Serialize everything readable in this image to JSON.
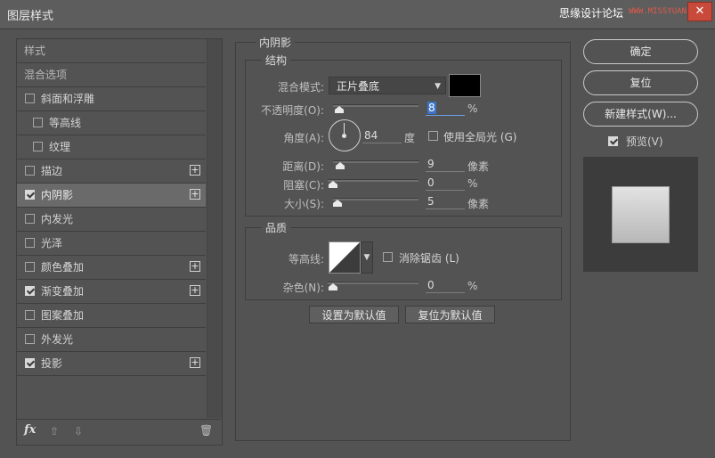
{
  "window": {
    "title": "图层样式",
    "watermark_cn": "思缘设计论坛",
    "watermark_url": "WWW.MISSYUAN.COM",
    "close_glyph": "✕"
  },
  "styles_panel": {
    "header_styles": "样式",
    "header_blend": "混合选项",
    "items": [
      {
        "label": "斜面和浮雕",
        "checked": false,
        "has_plus": false
      },
      {
        "label": "等高线",
        "checked": false,
        "has_plus": false
      },
      {
        "label": "纹理",
        "checked": false,
        "has_plus": false
      },
      {
        "label": "描边",
        "checked": false,
        "has_plus": true
      },
      {
        "label": "内阴影",
        "checked": true,
        "has_plus": true,
        "active": true
      },
      {
        "label": "内发光",
        "checked": false,
        "has_plus": false
      },
      {
        "label": "光泽",
        "checked": false,
        "has_plus": false
      },
      {
        "label": "颜色叠加",
        "checked": false,
        "has_plus": true
      },
      {
        "label": "渐变叠加",
        "checked": true,
        "has_plus": true
      },
      {
        "label": "图案叠加",
        "checked": false,
        "has_plus": false
      },
      {
        "label": "外发光",
        "checked": false,
        "has_plus": false
      },
      {
        "label": "投影",
        "checked": true,
        "has_plus": true
      }
    ],
    "plus_glyph": "+",
    "fx_label": "fx",
    "up_glyph": "⇧",
    "down_glyph": "⇩",
    "trash_glyph": "🗑"
  },
  "inner_shadow": {
    "section_title": "内阴影",
    "structure": {
      "title": "结构",
      "blend_mode_label": "混合模式:",
      "blend_mode_value": "正片叠底",
      "swatch_color": "#000000",
      "opacity_label": "不透明度(O):",
      "opacity_value": "8",
      "opacity_unit": "%",
      "angle_label": "角度(A):",
      "angle_value": "84",
      "angle_unit": "度",
      "global_light_label": "使用全局光 (G)",
      "global_light_checked": false,
      "distance_label": "距离(D):",
      "distance_value": "9",
      "distance_unit": "像素",
      "choke_label": "阻塞(C):",
      "choke_value": "0",
      "choke_unit": "%",
      "size_label": "大小(S):",
      "size_value": "5",
      "size_unit": "像素"
    },
    "quality": {
      "title": "品质",
      "contour_label": "等高线:",
      "antialias_label": "消除锯齿 (L)",
      "antialias_checked": false,
      "noise_label": "杂色(N):",
      "noise_value": "0",
      "noise_unit": "%"
    },
    "make_default_label": "设置为默认值",
    "reset_default_label": "复位为默认值"
  },
  "right": {
    "ok_label": "确定",
    "reset_label": "复位",
    "new_style_label": "新建样式(W)...",
    "preview_label": "预览(V)",
    "preview_checked": true
  }
}
